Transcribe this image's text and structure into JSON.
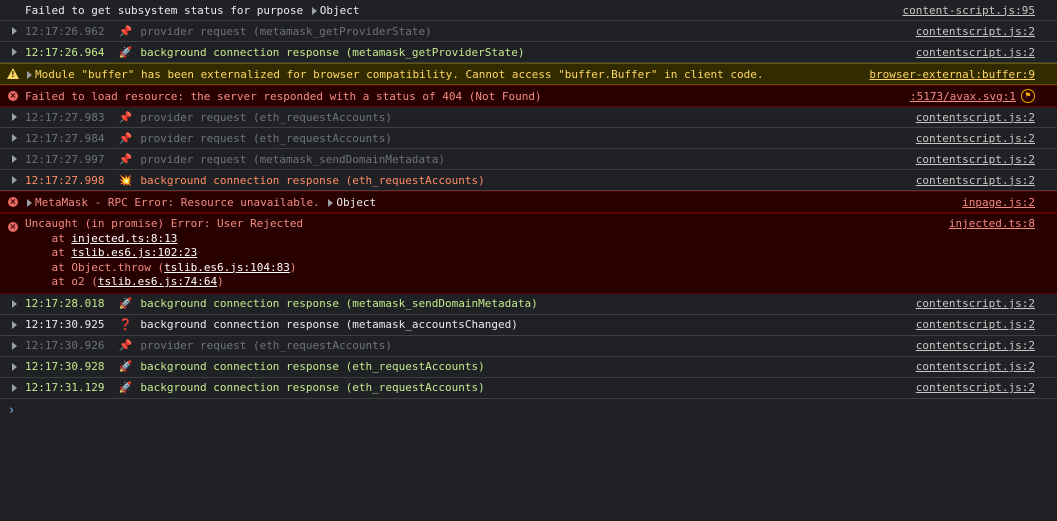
{
  "rows": [
    {
      "type": "plain",
      "message": "Failed to get subsystem status for purpose ",
      "object": "Object",
      "source": "content-script.js:95"
    },
    {
      "type": "dim",
      "time": "12:17:26.962",
      "icon": "pin-icon",
      "glyph": "📌",
      "message": "provider request (metamask_getProviderState)",
      "source": "contentscript.js:2"
    },
    {
      "type": "green",
      "time": "12:17:26.964",
      "icon": "rocket-icon",
      "glyph": "🚀",
      "message": "background connection response (metamask_getProviderState)",
      "source": "contentscript.js:2"
    },
    {
      "type": "warn",
      "message": "Module \"buffer\" has been externalized for browser compatibility. Cannot access \"buffer.Buffer\" in client code.",
      "source": "browser-external:buffer:9"
    },
    {
      "type": "err",
      "message": "Failed to load resource: the server responded with a status of 404 (Not Found)",
      "source": ":5173/avax.svg:1"
    },
    {
      "type": "dim",
      "time": "12:17:27.983",
      "icon": "pin-icon",
      "glyph": "📌",
      "message": "provider request (eth_requestAccounts)",
      "source": "contentscript.js:2"
    },
    {
      "type": "dim",
      "time": "12:17:27.984",
      "icon": "pin-icon",
      "glyph": "📌",
      "message": "provider request (eth_requestAccounts)",
      "source": "contentscript.js:2"
    },
    {
      "type": "dim",
      "time": "12:17:27.997",
      "icon": "pin-icon",
      "glyph": "📌",
      "message": "provider request (metamask_sendDomainMetadata)",
      "source": "contentscript.js:2"
    },
    {
      "type": "orange",
      "time": "12:17:27.998",
      "icon": "explosion-icon",
      "glyph": "💥",
      "message": "background connection response (eth_requestAccounts)",
      "source": "contentscript.js:2"
    },
    {
      "type": "err-expand",
      "message": "MetaMask - RPC Error: Resource unavailable. ",
      "object": "Object",
      "source": "inpage.js:2"
    },
    {
      "type": "err-stack",
      "message": "Uncaught (in promise) Error: User Rejected",
      "source": "injected.ts:8",
      "stack": [
        {
          "prefix": "    at ",
          "link": "injected.ts:8:13",
          "suffix": ""
        },
        {
          "prefix": "    at ",
          "link": "tslib.es6.js:102:23",
          "suffix": ""
        },
        {
          "prefix": "    at Object.throw (",
          "link": "tslib.es6.js:104:83",
          "suffix": ")"
        },
        {
          "prefix": "    at o2 (",
          "link": "tslib.es6.js:74:64",
          "suffix": ")"
        }
      ]
    },
    {
      "type": "green",
      "time": "12:17:28.018",
      "icon": "rocket-icon",
      "glyph": "🚀",
      "message": "background connection response (metamask_sendDomainMetadata)",
      "source": "contentscript.js:2"
    },
    {
      "type": "white",
      "time": "12:17:30.925",
      "icon": "question-icon",
      "glyph": "❓",
      "message": "background connection response (metamask_accountsChanged)",
      "source": "contentscript.js:2"
    },
    {
      "type": "dim",
      "time": "12:17:30.926",
      "icon": "pin-icon",
      "glyph": "📌",
      "message": "provider request (eth_requestAccounts)",
      "source": "contentscript.js:2"
    },
    {
      "type": "green",
      "time": "12:17:30.928",
      "icon": "rocket-icon",
      "glyph": "🚀",
      "message": "background connection response (eth_requestAccounts)",
      "source": "contentscript.js:2"
    },
    {
      "type": "green",
      "time": "12:17:31.129",
      "icon": "rocket-icon",
      "glyph": "🚀",
      "message": "background connection response (eth_requestAccounts)",
      "source": "contentscript.js:2"
    }
  ],
  "prompt": {
    "icon": "chevron-right-icon",
    "glyph": "›"
  }
}
